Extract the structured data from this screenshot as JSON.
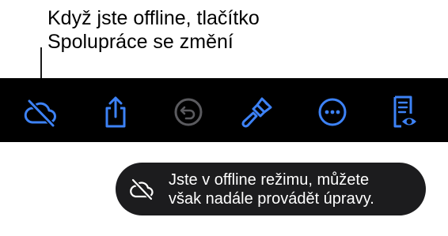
{
  "callout": {
    "line1": "Když jste offline, tlačítko",
    "line2": "Spolupráce se změní"
  },
  "toolbar": {
    "background": "#000000",
    "accent": "#3d82f6",
    "disabled": "#5a5a5e",
    "items": [
      {
        "icon": "cloud-slash-icon",
        "enabled": true
      },
      {
        "icon": "share-icon",
        "enabled": true
      },
      {
        "icon": "undo-icon",
        "enabled": false
      },
      {
        "icon": "paintbrush-icon",
        "enabled": true
      },
      {
        "icon": "more-icon",
        "enabled": true
      },
      {
        "icon": "reader-view-icon",
        "enabled": true
      }
    ]
  },
  "toast": {
    "icon": "cloud-slash-icon",
    "line1": "Jste v offline režimu, můžete",
    "line2": "však nadále provádět úpravy."
  }
}
